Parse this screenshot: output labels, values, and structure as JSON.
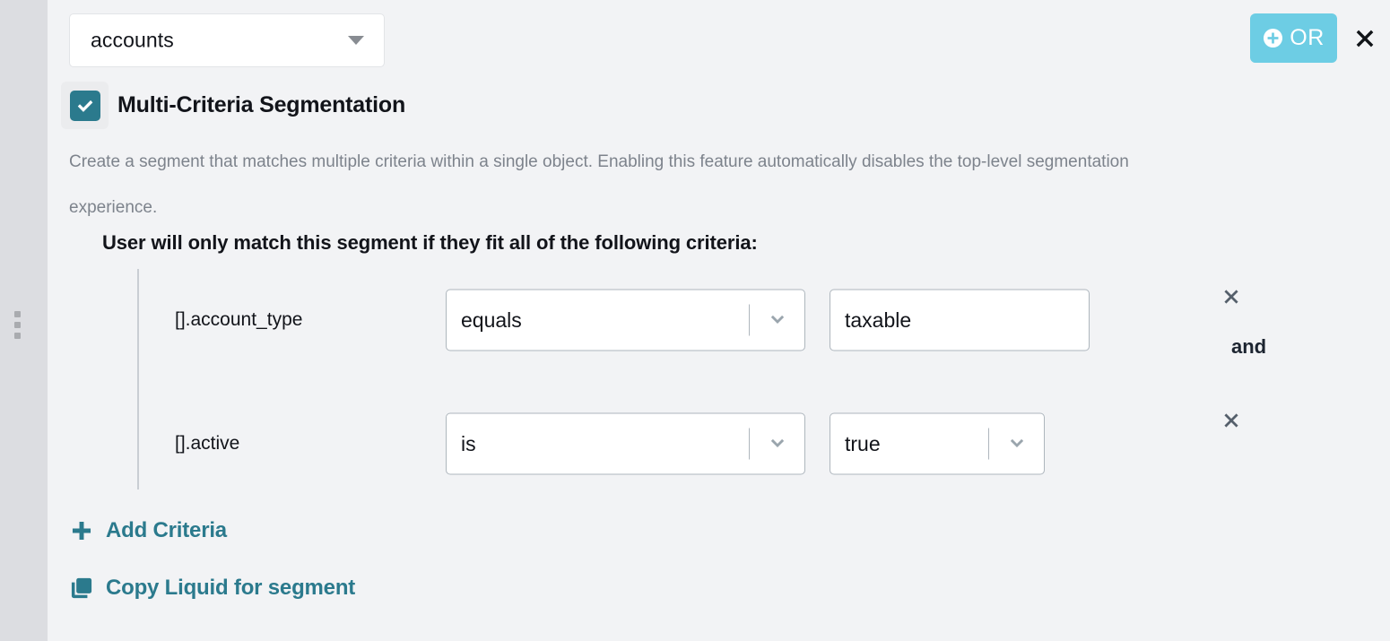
{
  "colors": {
    "teal": "#2b7a8d",
    "or_button_bg": "#6dcde4",
    "page_bg": "#f2f3f5",
    "rail_bg": "#dcdde1",
    "muted_text": "#7d838c",
    "x_icon": "#555f6b"
  },
  "rail": {
    "handle_icon": "drag-handle-icon"
  },
  "header": {
    "object_select": {
      "value": "accounts",
      "caret_icon": "caret-down-icon"
    },
    "or_button": {
      "label": "OR",
      "icon": "plus-circle-icon"
    },
    "close_icon": "close-icon"
  },
  "multi_criteria": {
    "checkbox_label": "Multi-Criteria Segmentation",
    "checkbox_checked": true,
    "check_icon": "check-icon",
    "description": "Create a segment that matches multiple criteria within a single object. Enabling this feature automatically disables the top-level segmentation experience.",
    "criteria_heading": "User will only match this segment if they fit all of the following criteria:"
  },
  "criteria": [
    {
      "field": "[].account_type",
      "operator": "equals",
      "operator_icon": "chevron-down-icon",
      "value": "taxable",
      "value_type": "text",
      "remove_icon": "close-icon",
      "joiner": "and"
    },
    {
      "field": "[].active",
      "operator": "is",
      "operator_icon": "chevron-down-icon",
      "value": "true",
      "value_type": "select",
      "value_icon": "chevron-down-icon",
      "remove_icon": "close-icon",
      "joiner": ""
    }
  ],
  "footer": {
    "add_criteria": {
      "label": "Add Criteria",
      "icon": "plus-icon"
    },
    "copy_liquid": {
      "label": "Copy Liquid for segment",
      "icon": "copy-icon"
    }
  }
}
